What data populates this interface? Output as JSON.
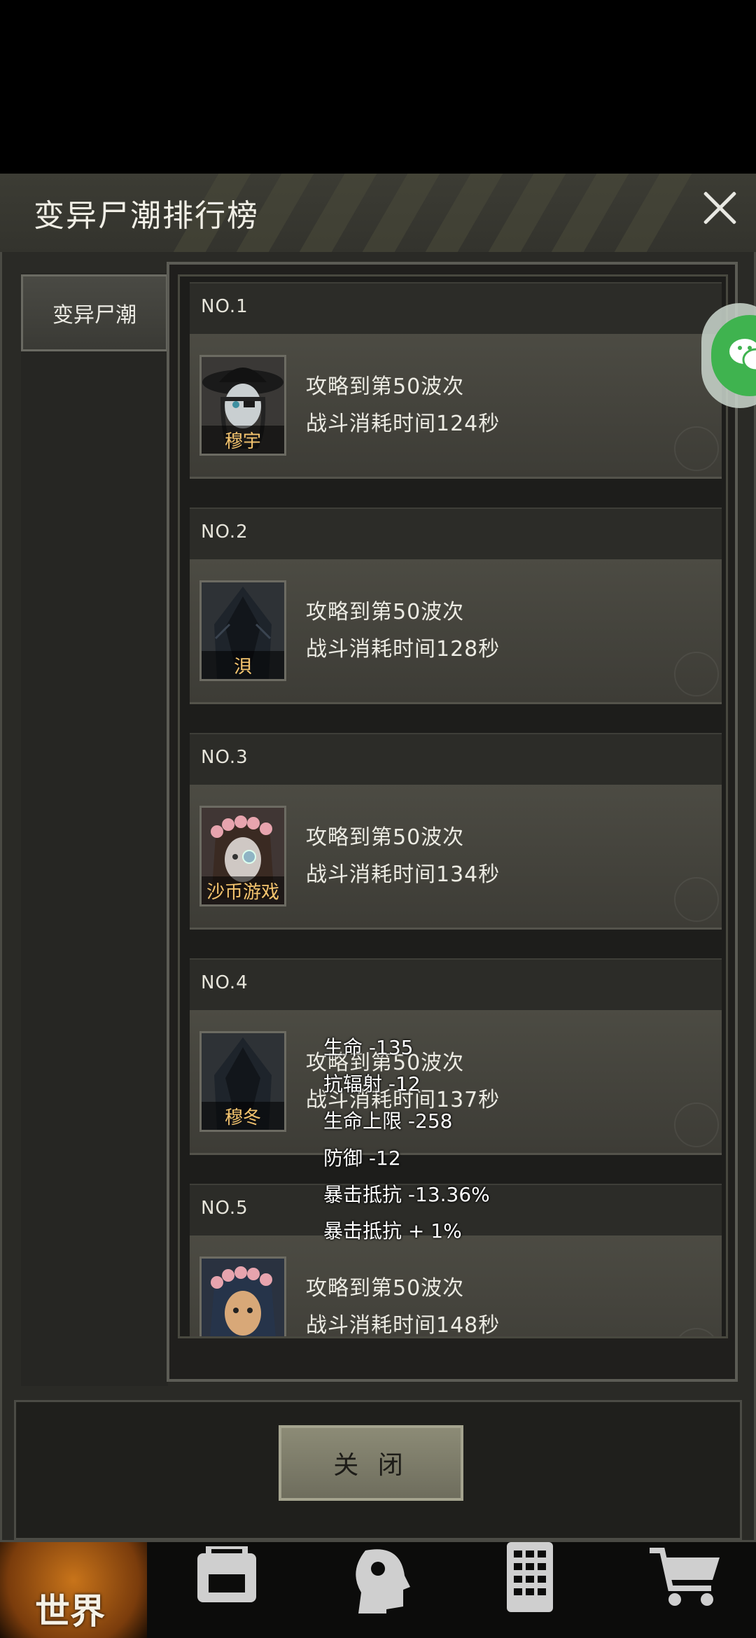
{
  "dialog": {
    "title": "变异尸潮排行榜",
    "tab_label": "变异尸潮",
    "close_button": "关 闭"
  },
  "ranking": [
    {
      "rank": "NO.1",
      "name": "穆宇",
      "line1": "攻略到第50波次",
      "line2": "战斗消耗时间124秒"
    },
    {
      "rank": "NO.2",
      "name": "浿",
      "line1": "攻略到第50波次",
      "line2": "战斗消耗时间128秒"
    },
    {
      "rank": "NO.3",
      "name": "沙币游戏",
      "line1": "攻略到第50波次",
      "line2": "战斗消耗时间134秒"
    },
    {
      "rank": "NO.4",
      "name": "穆冬",
      "line1": "攻略到第50波次",
      "line2": "战斗消耗时间137秒"
    },
    {
      "rank": "NO.5",
      "name": "",
      "line1": "攻略到第50波次",
      "line2": "战斗消耗时间148秒"
    }
  ],
  "floating_stats": [
    "生命 -135",
    "抗辐射 -12",
    "生命上限 -258",
    "防御 -12",
    "暴击抵抗 -13.36%",
    "暴击抵抗 + 1%"
  ],
  "bottom_nav": {
    "world_label": "世界",
    "icons": [
      "backpack-icon",
      "head-skill-icon",
      "phone-keypad-icon",
      "shopping-cart-icon"
    ]
  },
  "colors": {
    "name_gold": "#f4c46e",
    "wechat_green": "#3fb34f"
  }
}
